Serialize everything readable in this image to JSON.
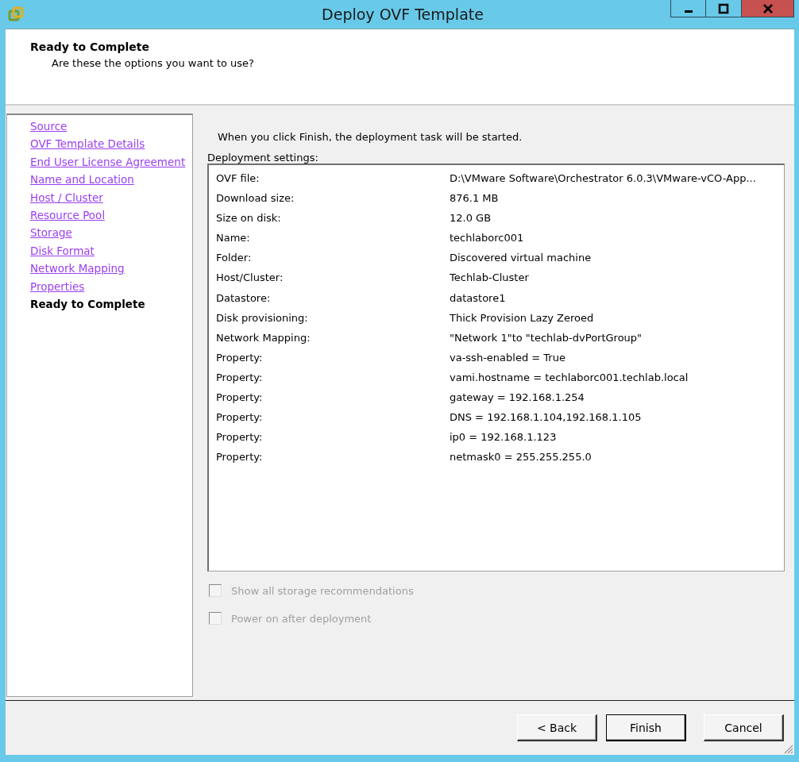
{
  "window": {
    "title": "Deploy OVF Template"
  },
  "header": {
    "title": "Ready to Complete",
    "subtitle": "Are these the options you want to use?"
  },
  "sidebar": {
    "items": [
      {
        "label": "Source",
        "selected": false
      },
      {
        "label": "OVF Template Details",
        "selected": false
      },
      {
        "label": "End User License Agreement",
        "selected": false
      },
      {
        "label": "Name and Location",
        "selected": false
      },
      {
        "label": "Host / Cluster",
        "selected": false
      },
      {
        "label": "Resource Pool",
        "selected": false
      },
      {
        "label": "Storage",
        "selected": false
      },
      {
        "label": "Disk Format",
        "selected": false
      },
      {
        "label": "Network Mapping",
        "selected": false
      },
      {
        "label": "Properties",
        "selected": false
      },
      {
        "label": "Ready to Complete",
        "selected": true
      }
    ]
  },
  "intro": "When you click Finish, the deployment task will be started.",
  "settings": {
    "label": "Deployment settings:",
    "rows": [
      {
        "name": "OVF file:",
        "value": "D:\\VMware Software\\Orchestrator 6.0.3\\VMware-vCO-App..."
      },
      {
        "name": "Download size:",
        "value": "876.1 MB"
      },
      {
        "name": "Size on disk:",
        "value": "12.0 GB"
      },
      {
        "name": "Name:",
        "value": "techlaborc001"
      },
      {
        "name": "Folder:",
        "value": "Discovered virtual machine"
      },
      {
        "name": "Host/Cluster:",
        "value": "Techlab-Cluster"
      },
      {
        "name": "Datastore:",
        "value": "datastore1"
      },
      {
        "name": "Disk provisioning:",
        "value": "Thick Provision Lazy Zeroed"
      },
      {
        "name": "Network Mapping:",
        "value": "\"Network 1\"to \"techlab-dvPortGroup\""
      },
      {
        "name": "Property:",
        "value": "va-ssh-enabled = True"
      },
      {
        "name": "Property:",
        "value": "vami.hostname = techlaborc001.techlab.local"
      },
      {
        "name": "Property:",
        "value": "gateway = 192.168.1.254"
      },
      {
        "name": "Property:",
        "value": "DNS = 192.168.1.104,192.168.1.105"
      },
      {
        "name": "Property:",
        "value": "ip0 = 192.168.1.123"
      },
      {
        "name": "Property:",
        "value": "netmask0 = 255.255.255.0"
      }
    ]
  },
  "options": [
    {
      "label": "Show all storage recommendations",
      "checked": false,
      "disabled": true
    },
    {
      "label": "Power on after deployment",
      "checked": false,
      "disabled": true
    }
  ],
  "buttons": [
    {
      "label": "< Back",
      "default": false
    },
    {
      "label": "Finish",
      "default": true
    },
    {
      "label": "Cancel",
      "default": false
    }
  ]
}
